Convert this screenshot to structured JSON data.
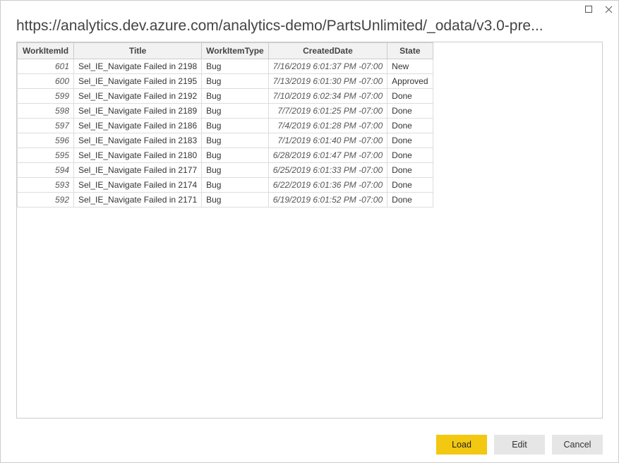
{
  "window": {
    "url": "https://analytics.dev.azure.com/analytics-demo/PartsUnlimited/_odata/v3.0-pre..."
  },
  "table": {
    "headers": {
      "id": "WorkItemId",
      "title": "Title",
      "type": "WorkItemType",
      "date": "CreatedDate",
      "state": "State"
    },
    "rows": [
      {
        "id": "601",
        "title": "Sel_IE_Navigate Failed in 2198",
        "type": "Bug",
        "date": "7/16/2019 6:01:37 PM -07:00",
        "state": "New"
      },
      {
        "id": "600",
        "title": "Sel_IE_Navigate Failed in 2195",
        "type": "Bug",
        "date": "7/13/2019 6:01:30 PM -07:00",
        "state": "Approved"
      },
      {
        "id": "599",
        "title": "Sel_IE_Navigate Failed in 2192",
        "type": "Bug",
        "date": "7/10/2019 6:02:34 PM -07:00",
        "state": "Done"
      },
      {
        "id": "598",
        "title": "Sel_IE_Navigate Failed in 2189",
        "type": "Bug",
        "date": "7/7/2019 6:01:25 PM -07:00",
        "state": "Done"
      },
      {
        "id": "597",
        "title": "Sel_IE_Navigate Failed in 2186",
        "type": "Bug",
        "date": "7/4/2019 6:01:28 PM -07:00",
        "state": "Done"
      },
      {
        "id": "596",
        "title": "Sel_IE_Navigate Failed in 2183",
        "type": "Bug",
        "date": "7/1/2019 6:01:40 PM -07:00",
        "state": "Done"
      },
      {
        "id": "595",
        "title": "Sel_IE_Navigate Failed in 2180",
        "type": "Bug",
        "date": "6/28/2019 6:01:47 PM -07:00",
        "state": "Done"
      },
      {
        "id": "594",
        "title": "Sel_IE_Navigate Failed in 2177",
        "type": "Bug",
        "date": "6/25/2019 6:01:33 PM -07:00",
        "state": "Done"
      },
      {
        "id": "593",
        "title": "Sel_IE_Navigate Failed in 2174",
        "type": "Bug",
        "date": "6/22/2019 6:01:36 PM -07:00",
        "state": "Done"
      },
      {
        "id": "592",
        "title": "Sel_IE_Navigate Failed in 2171",
        "type": "Bug",
        "date": "6/19/2019 6:01:52 PM -07:00",
        "state": "Done"
      }
    ]
  },
  "buttons": {
    "load": "Load",
    "edit": "Edit",
    "cancel": "Cancel"
  }
}
